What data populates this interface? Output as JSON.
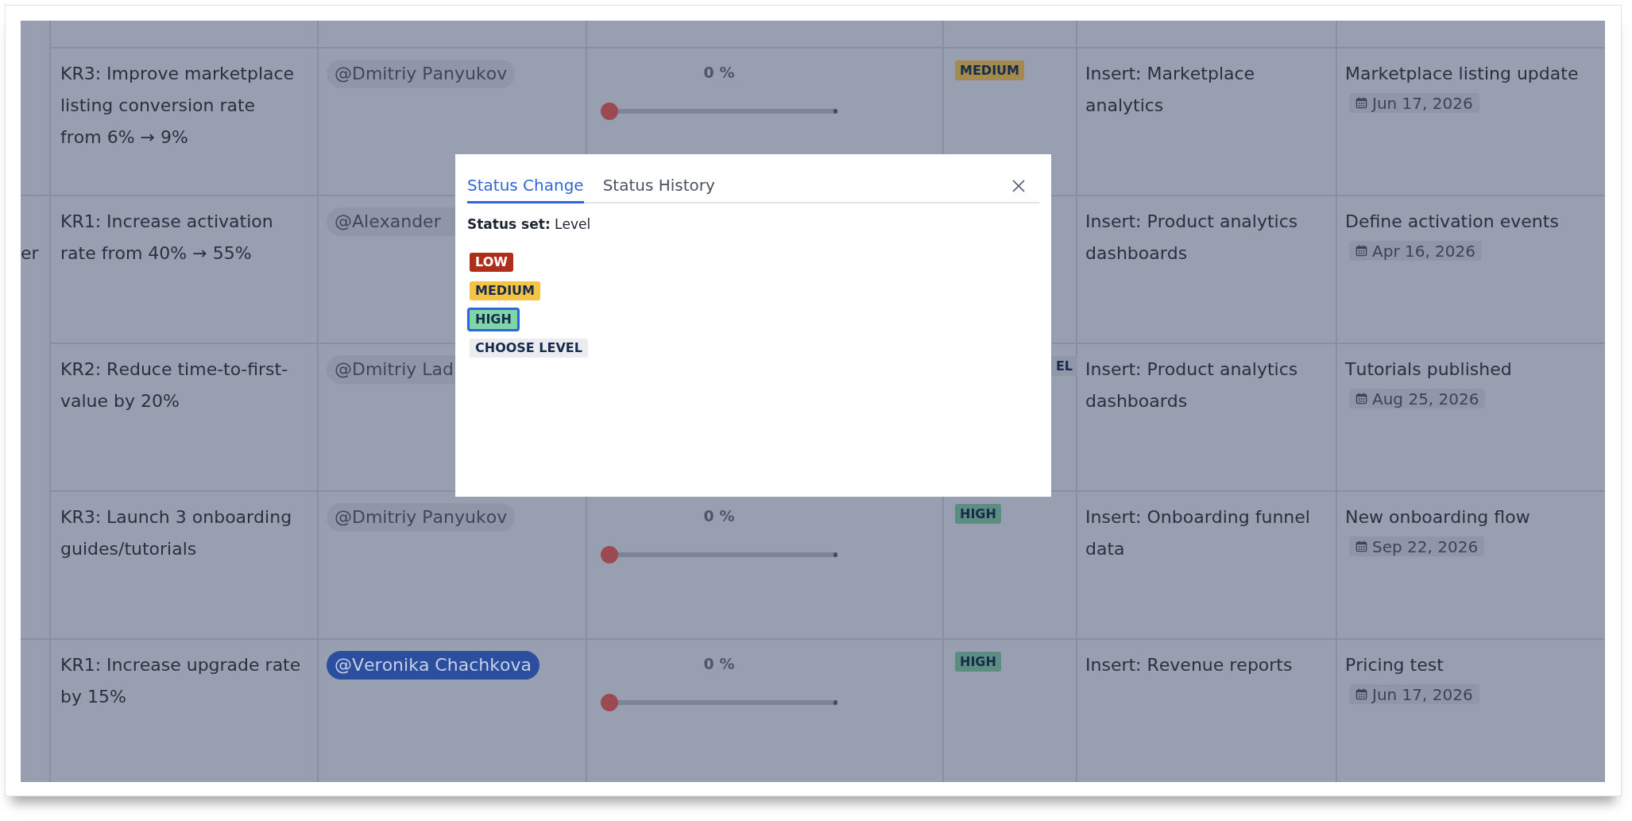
{
  "table": {
    "side_text": "er",
    "rows": [
      {
        "key_result": "KR3: Improve marketplace listing conversion rate from 6% → 9%",
        "owner": {
          "name": "@Dmitriy Panyukov",
          "kind": "mention",
          "cut_off": false
        },
        "progress": {
          "reading": "0 %",
          "level": 0
        },
        "status": {
          "label": "MEDIUM",
          "color": "#a28b4d",
          "cut_off": false
        },
        "insert": "Insert: Marketplace analytics",
        "milestone": {
          "title": "Marketplace listing update",
          "date": "Jun 17, 2026"
        }
      },
      {
        "key_result": "KR1: Increase activation rate from 40% → 55%",
        "owner": {
          "name": "@Alexander",
          "kind": "mention",
          "cut_off": true
        },
        "insert": "Insert: Product analytics dashboards",
        "milestone": {
          "title": "Define activation events",
          "date": "Apr 16, 2026"
        }
      },
      {
        "key_result": "KR2: Reduce time-to-first-value by 20%",
        "owner": {
          "name": "@Dmitriy Lad",
          "kind": "mention",
          "cut_off": true
        },
        "status": {
          "label": "EL",
          "color": "#8f97a9",
          "cut_off": true
        },
        "insert": "Insert: Product analytics dashboards",
        "milestone": {
          "title": "Tutorials published",
          "date": "Aug 25, 2026"
        }
      },
      {
        "key_result": "KR3: Launch 3 onboarding guides/tutorials",
        "owner": {
          "name": "@Dmitriy Panyukov",
          "kind": "mention",
          "cut_off": false
        },
        "progress": {
          "reading": "0 %",
          "level": 0
        },
        "status": {
          "label": "HIGH",
          "color": "#5b8e81",
          "cut_off": false
        },
        "insert": "Insert: Onboarding funnel data",
        "milestone": {
          "title": "New onboarding flow",
          "date": "Sep 22, 2026"
        }
      },
      {
        "key_result": "KR1: Increase upgrade rate by 15%",
        "owner": {
          "name": "@Veronika Chachkova",
          "kind": "self_mention",
          "cut_off": false
        },
        "progress": {
          "reading": "0 %",
          "level": 0
        },
        "status": {
          "label": "HIGH",
          "color": "#5b8e81",
          "cut_off": false
        },
        "insert": "Insert: Revenue reports",
        "milestone": {
          "title": "Pricing test",
          "date": "Jun 17, 2026"
        }
      }
    ]
  },
  "popup": {
    "tabs": [
      {
        "label": "Status Change",
        "selected": true
      },
      {
        "label": "Status History",
        "selected": false
      }
    ],
    "status_set": "**Status set:** Level",
    "options": [
      {
        "label": "LOW",
        "color": "#ae2e1a",
        "selected": false
      },
      {
        "label": "MEDIUM",
        "color": "#f5c444",
        "selected": false
      },
      {
        "label": "HIGH",
        "color": "#7fd5a8",
        "selected": true
      },
      {
        "label": "CHOOSE LEVEL",
        "color": "#eaecf0",
        "selected": false
      }
    ]
  }
}
